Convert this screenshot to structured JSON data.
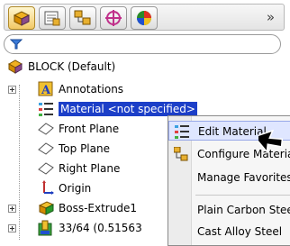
{
  "toolbar": {
    "tabs": [
      {
        "name": "feature-manager",
        "icon": "feature-manager-icon"
      },
      {
        "name": "property-manager",
        "icon": "property-manager-icon"
      },
      {
        "name": "configuration-manager",
        "icon": "configuration-manager-icon"
      },
      {
        "name": "dimxpert-manager",
        "icon": "dimxpert-icon"
      },
      {
        "name": "display-manager",
        "icon": "display-manager-icon"
      }
    ],
    "overflow_label": "»"
  },
  "filter": {
    "icon": "filter-icon"
  },
  "tree": {
    "root_label": "BLOCK  (Default)",
    "items": [
      {
        "label": "Annotations",
        "icon": "annotations-icon",
        "expandable": true
      },
      {
        "label": "Material <not specified>",
        "icon": "material-icon",
        "selected": true
      },
      {
        "label": "Front Plane",
        "icon": "plane-icon"
      },
      {
        "label": "Top Plane",
        "icon": "plane-icon"
      },
      {
        "label": "Right Plane",
        "icon": "plane-icon"
      },
      {
        "label": "Origin",
        "icon": "origin-icon"
      },
      {
        "label": "Boss-Extrude1",
        "icon": "extrude-icon",
        "expandable": true
      },
      {
        "label": "33/64 (0.51563",
        "icon": "hole-icon",
        "expandable": true
      }
    ]
  },
  "context_menu": {
    "items": [
      {
        "label": "Edit Material",
        "icon": "edit-material-icon",
        "hover": true
      },
      {
        "label": "Configure Material",
        "icon": "configure-material-icon"
      },
      {
        "label": "Manage Favorites"
      },
      {
        "label": "Plain Carbon Steel"
      },
      {
        "label": "Cast Alloy Steel"
      }
    ]
  },
  "colors": {
    "selection": "#1c3fc8",
    "menu_hover": "#dfe6ff"
  }
}
